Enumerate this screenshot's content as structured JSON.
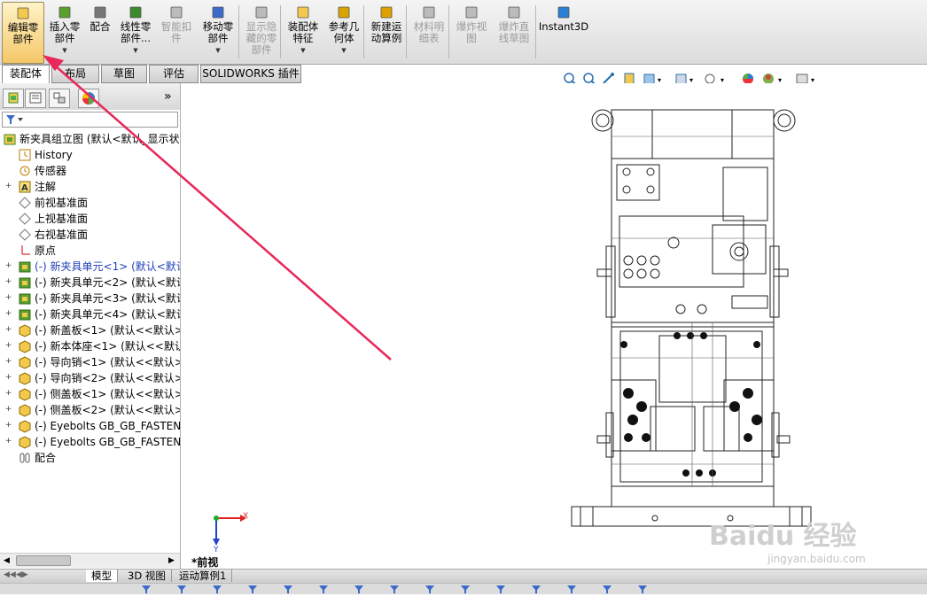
{
  "ribbon": {
    "buttons": [
      {
        "id": "edit-component",
        "label": "编辑零\n部件",
        "state": "active"
      },
      {
        "id": "insert-component",
        "label": "插入零\n部件",
        "state": "normal",
        "dropdown": true
      },
      {
        "id": "mate",
        "label": "配合",
        "state": "normal"
      },
      {
        "id": "linear-pattern",
        "label": "线性零\n部件...",
        "state": "normal",
        "dropdown": true
      },
      {
        "id": "smart-fastener",
        "label": "智能扣\n件",
        "state": "disabled"
      },
      {
        "id": "move-component",
        "label": "移动零\n部件",
        "state": "normal",
        "dropdown": true
      },
      {
        "id": "show-hidden",
        "label": "显示隐\n藏的零\n部件",
        "state": "disabled"
      },
      {
        "id": "assembly-features",
        "label": "装配体\n特征",
        "state": "normal",
        "dropdown": true
      },
      {
        "id": "reference-geometry",
        "label": "参考几\n何体",
        "state": "normal",
        "dropdown": true
      },
      {
        "id": "new-motion-study",
        "label": "新建运\n动算例",
        "state": "normal"
      },
      {
        "id": "bom",
        "label": "材料明\n细表",
        "state": "disabled"
      },
      {
        "id": "exploded-view",
        "label": "爆炸视\n图",
        "state": "disabled"
      },
      {
        "id": "explode-line",
        "label": "爆炸直\n线草图",
        "state": "disabled"
      },
      {
        "id": "instant3d",
        "label": "Instant3D",
        "state": "normal"
      }
    ]
  },
  "tabs": [
    "装配体",
    "布局",
    "草图",
    "评估",
    "SOLIDWORKS 插件"
  ],
  "tree": {
    "nodes": [
      {
        "label": "新夹具组立图 (默认<默认_显示状",
        "icon": "assembly-icon",
        "expand": "",
        "blue": false,
        "indent": 0
      },
      {
        "label": "History",
        "icon": "history-icon",
        "expand": "",
        "blue": false,
        "indent": 1
      },
      {
        "label": "传感器",
        "icon": "sensor-icon",
        "expand": "",
        "blue": false,
        "indent": 1
      },
      {
        "label": "注解",
        "icon": "annotation-icon",
        "expand": "+",
        "blue": false,
        "indent": 1
      },
      {
        "label": "前视基准面",
        "icon": "plane-icon",
        "expand": "",
        "blue": false,
        "indent": 1
      },
      {
        "label": "上视基准面",
        "icon": "plane-icon",
        "expand": "",
        "blue": false,
        "indent": 1
      },
      {
        "label": "右视基准面",
        "icon": "plane-icon",
        "expand": "",
        "blue": false,
        "indent": 1
      },
      {
        "label": "原点",
        "icon": "origin-icon",
        "expand": "",
        "blue": false,
        "indent": 1
      },
      {
        "label": "(-) 新夹具单元<1> (默认<默认",
        "icon": "subassembly-icon",
        "expand": "+",
        "blue": true,
        "indent": 1
      },
      {
        "label": "(-) 新夹具单元<2> (默认<默认",
        "icon": "subassembly-icon",
        "expand": "+",
        "blue": false,
        "indent": 1
      },
      {
        "label": "(-) 新夹具单元<3> (默认<默认",
        "icon": "subassembly-icon",
        "expand": "+",
        "blue": false,
        "indent": 1
      },
      {
        "label": "(-) 新夹具单元<4> (默认<默认",
        "icon": "subassembly-icon",
        "expand": "+",
        "blue": false,
        "indent": 1
      },
      {
        "label": "(-) 新盖板<1> (默认<<默认>",
        "icon": "part-icon",
        "expand": "+",
        "blue": false,
        "indent": 1
      },
      {
        "label": "(-) 新本体座<1> (默认<<默认>",
        "icon": "part-icon",
        "expand": "+",
        "blue": false,
        "indent": 1
      },
      {
        "label": "(-) 导向销<1> (默认<<默认>",
        "icon": "part-icon",
        "expand": "+",
        "blue": false,
        "indent": 1
      },
      {
        "label": "(-) 导向销<2> (默认<<默认>",
        "icon": "part-icon",
        "expand": "+",
        "blue": false,
        "indent": 1
      },
      {
        "label": "(-) 侧盖板<1> (默认<<默认>",
        "icon": "part-icon",
        "expand": "+",
        "blue": false,
        "indent": 1
      },
      {
        "label": "(-) 侧盖板<2> (默认<<默认>",
        "icon": "part-icon",
        "expand": "+",
        "blue": false,
        "indent": 1
      },
      {
        "label": "(-) Eyebolts GB_GB_FASTEN",
        "icon": "part-icon",
        "expand": "+",
        "blue": false,
        "indent": 1
      },
      {
        "label": "(-) Eyebolts GB_GB_FASTEN",
        "icon": "part-icon",
        "expand": "+",
        "blue": false,
        "indent": 1
      },
      {
        "label": "配合",
        "icon": "mates-icon",
        "expand": "",
        "blue": false,
        "indent": 1
      }
    ]
  },
  "bottom_tabs": [
    "模型",
    "3D 视图",
    "运动算例1"
  ],
  "view_name": "*前视",
  "axis": {
    "x": "X",
    "y": "Y"
  },
  "watermark": {
    "main": "Baidu 经验",
    "sub": "jingyan.baidu.com"
  },
  "colors": {
    "arrow": "#e8285a",
    "accent": "#1f3fb8"
  }
}
